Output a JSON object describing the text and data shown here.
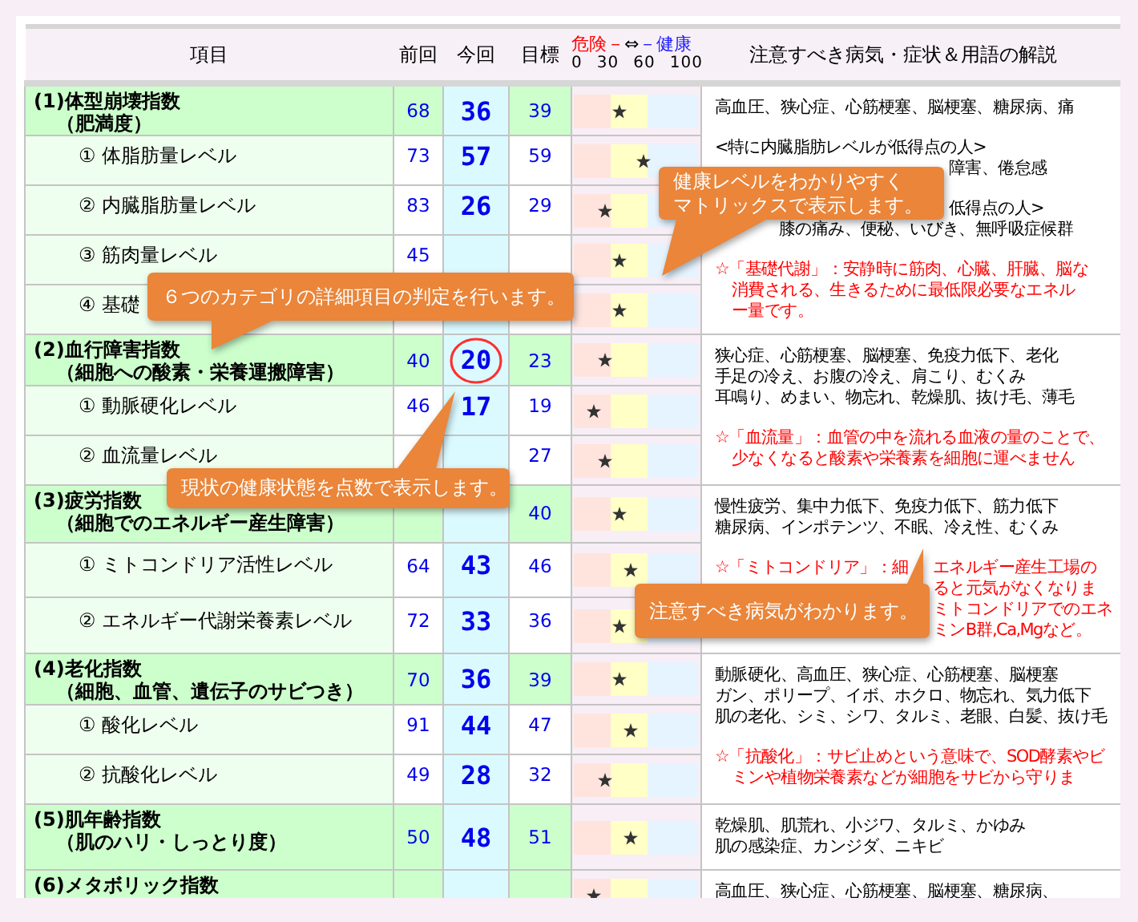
{
  "columns": {
    "item": "項目",
    "prev": "前回",
    "cur": "今回",
    "target": "目標",
    "notes": "注意すべき病気・症状＆用語の解説"
  },
  "matrix_header": {
    "danger": "危険－",
    "arrow": "⇔",
    "healthy": "－健康",
    "scale": [
      "0",
      "30",
      "60",
      "100"
    ]
  },
  "groups": [
    {
      "label": "(1)体型崩壊指数",
      "sublabel": "（肥満度）",
      "prev": "68",
      "cur": "36",
      "target": "39",
      "level": 0.36,
      "circled": false,
      "items": [
        {
          "label": "① 体脂肪量レベル",
          "prev": "73",
          "cur": "57",
          "target": "59",
          "level": 0.56
        },
        {
          "label": "② 内臓脂肪量レベル",
          "prev": "83",
          "cur": "26",
          "target": "29",
          "level": 0.25
        },
        {
          "label": "③ 筋肉量レベル",
          "prev": "45",
          "level": 0.36
        },
        {
          "label": "④ 基礎",
          "level": 0.36
        }
      ],
      "notes": [
        {
          "kind": "plain",
          "lines": [
            "高血圧、狭心症、心筋梗塞、脳梗塞、糖尿病、痛"
          ]
        },
        {
          "kind": "subgroup",
          "lines": [
            "<特に内臓脂肪レベルが低得点の人>"
          ]
        },
        {
          "kind": "covered",
          "lines": [
            [
              "障害、倦怠感"
            ]
          ]
        },
        {
          "kind": "covered",
          "lines": [
            [
              "低得点の人>"
            ],
            [
              "膝の痛み、便秘、いびき、無呼吸症候群"
            ]
          ]
        },
        {
          "kind": "term",
          "lines": [
            "☆「基礎代謝」：安静時に筋肉、心臓、肝臓、脳な",
            "消費される、生きるために最低限必要なエネル",
            "ー量です。"
          ]
        }
      ]
    },
    {
      "label": "(2)血行障害指数",
      "sublabel": "（細胞への酸素・栄養運搬障害）",
      "prev": "40",
      "cur": "20",
      "target": "23",
      "level": 0.25,
      "circled": true,
      "items": [
        {
          "label": "① 動脈硬化レベル",
          "prev": "46",
          "cur": "17",
          "target": "19",
          "level": 0.16
        },
        {
          "label": "② 血流量レベル",
          "target": "27",
          "level": 0.25
        }
      ],
      "notes": [
        {
          "kind": "plain",
          "lines": [
            "狭心症、心筋梗塞、脳梗塞、免疫力低下、老化",
            "手足の冷え、お腹の冷え、肩こり、むくみ",
            "耳鳴り、めまい、物忘れ、乾燥肌、抜け毛、薄毛"
          ]
        },
        {
          "kind": "term",
          "lines": [
            "☆「血流量」：血管の中を流れる血液の量のことで、",
            "少なくなると酸素や栄養素を細胞に運べません"
          ]
        }
      ]
    },
    {
      "label": "(3)疲労指数",
      "sublabel": "（細胞でのエネルギー産生障害）",
      "target": "40",
      "level": 0.36,
      "circled": false,
      "items": [
        {
          "label": "① ミトコンドリア活性レベル",
          "prev": "64",
          "cur": "43",
          "target": "46",
          "level": 0.45
        },
        {
          "label": "② エネルギー代謝栄養素レベル",
          "prev": "72",
          "cur": "33",
          "target": "36",
          "level": 0.36
        }
      ],
      "notes": [
        {
          "kind": "plain",
          "lines": [
            "慢性疲労、集中力低下、免疫力低下、筋力低下",
            "糖尿病、インポテンツ、不眠、冷え性、むくみ"
          ]
        },
        {
          "kind": "covered-term",
          "lines": [
            [
              "☆「ミトコンドリア」：細",
              "エネルギー産生工場の"
            ],
            [
              "ると元気がなくなりま"
            ],
            [
              "ミトコンドリアでのエネ"
            ],
            [
              "ミンB群,Ca,Mgなど。"
            ]
          ]
        }
      ]
    },
    {
      "label": "(4)老化指数",
      "sublabel": "（細胞、血管、遺伝子のサビつき）",
      "prev": "70",
      "cur": "36",
      "target": "39",
      "level": 0.36,
      "circled": false,
      "items": [
        {
          "label": "① 酸化レベル",
          "prev": "91",
          "cur": "44",
          "target": "47",
          "level": 0.45
        },
        {
          "label": "② 抗酸化レベル",
          "prev": "49",
          "cur": "28",
          "target": "32",
          "level": 0.25
        }
      ],
      "notes": [
        {
          "kind": "plain",
          "lines": [
            "動脈硬化、高血圧、狭心症、心筋梗塞、脳梗塞",
            "ガン、ポリープ、イボ、ホクロ、物忘れ、気力低下",
            "肌の老化、シミ、シワ、タルミ、老眼、白髪、抜け毛"
          ]
        },
        {
          "kind": "term",
          "lines": [
            "☆「抗酸化」：サビ止めという意味で、SOD酵素やビ",
            "ミンや植物栄養素などが細胞をサビから守りま"
          ]
        }
      ]
    },
    {
      "label": "(5)肌年齢指数",
      "sublabel": "（肌のハリ・しっとり度）",
      "prev": "50",
      "cur": "48",
      "target": "51",
      "level": 0.45,
      "circled": false,
      "notes": [
        {
          "kind": "plain",
          "lines": [
            "乾燥肌、肌荒れ、小ジワ、タルミ、かゆみ",
            "肌の感染症、カンジダ、ニキビ"
          ]
        }
      ]
    },
    {
      "label": "(6)メタボリック指数",
      "level": 0.16,
      "circled": false,
      "notes": [
        {
          "kind": "plain",
          "lines": [
            "高血圧、狭心症、心筋梗塞、脳梗塞、糖尿病、"
          ]
        }
      ]
    }
  ],
  "callouts": [
    {
      "lines": [
        "６つのカテゴリの詳細項目の判定を行います。"
      ]
    },
    {
      "lines": [
        "健康レベルをわかりやすく",
        "マトリックスで表示します。"
      ]
    },
    {
      "lines": [
        "現状の健康状態を点数で表示します。"
      ]
    },
    {
      "lines": [
        "注意すべき病気がわかります。"
      ]
    }
  ]
}
